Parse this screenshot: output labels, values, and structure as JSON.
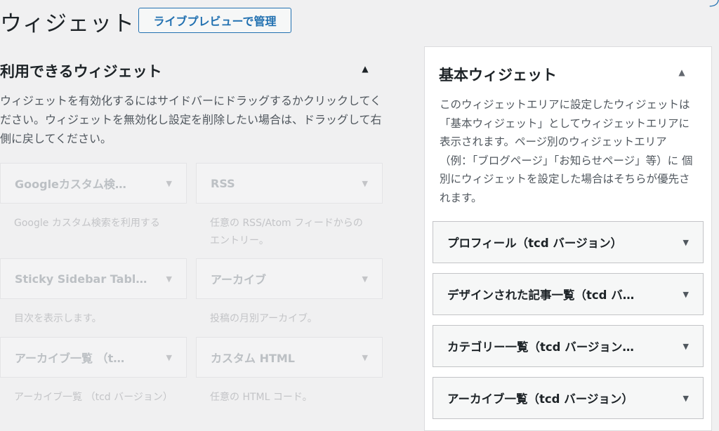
{
  "header": {
    "title": "ウィジェット",
    "live_preview_label": "ライブプレビューで管理"
  },
  "available": {
    "heading": "利用できるウィジェット",
    "description": "ウィジェットを有効化するにはサイドバーにドラッグするかクリックしてください。ウィジェットを無効化し設定を削除したい場合は、ドラッグして右側に戻してください。",
    "widgets": [
      {
        "title": "Googleカスタム検…",
        "desc": "Google カスタム検索を利用する"
      },
      {
        "title": "RSS",
        "desc": "任意の RSS/Atom フィードからのエントリー。"
      },
      {
        "title": "Sticky Sidebar Tabl…",
        "desc": "目次を表示します。"
      },
      {
        "title": "アーカイブ",
        "desc": "投稿の月別アーカイブ。"
      },
      {
        "title": "アーカイブ一覧 （t…",
        "desc": "アーカイブ一覧 （tcd バージョン）"
      },
      {
        "title": "カスタム HTML",
        "desc": "任意の HTML コード。"
      }
    ]
  },
  "sidebar": {
    "title": "基本ウィジェット",
    "description": "このウィジェットエリアに設定したウィジェットは「基本ウィジェット」としてウィジェットエリアに表示されます。ページ別のウィジェットエリア（例：「ブログページ」「お知らせページ」等）に 個別にウィジェットを設定した場合はそちらが優先されます。",
    "widgets": [
      {
        "title": "プロフィール（tcd バージョン）"
      },
      {
        "title": "デザインされた記事一覧（tcd バ…"
      },
      {
        "title": "カテゴリー一覧（tcd バージョン…"
      },
      {
        "title": "アーカイブ一覧（tcd バージョン）"
      }
    ]
  },
  "icons": {
    "collapse": "triangle-up-icon",
    "expand": "triangle-down-icon"
  }
}
